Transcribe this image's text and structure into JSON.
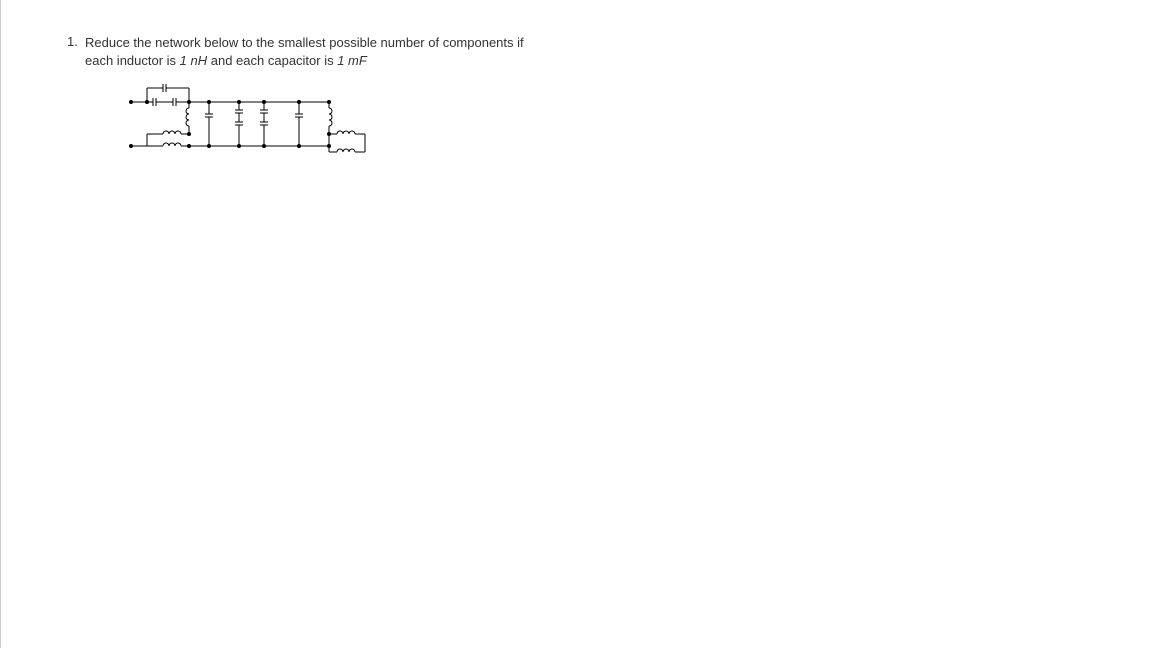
{
  "question": {
    "number": "1.",
    "line1_a": "Reduce the network below to the smallest possible number of components if",
    "line2_a": "each inductor is ",
    "inductor_val": "1 nH",
    "line2_b": " and each capacitor is ",
    "capacitor_val": "1 mF"
  }
}
